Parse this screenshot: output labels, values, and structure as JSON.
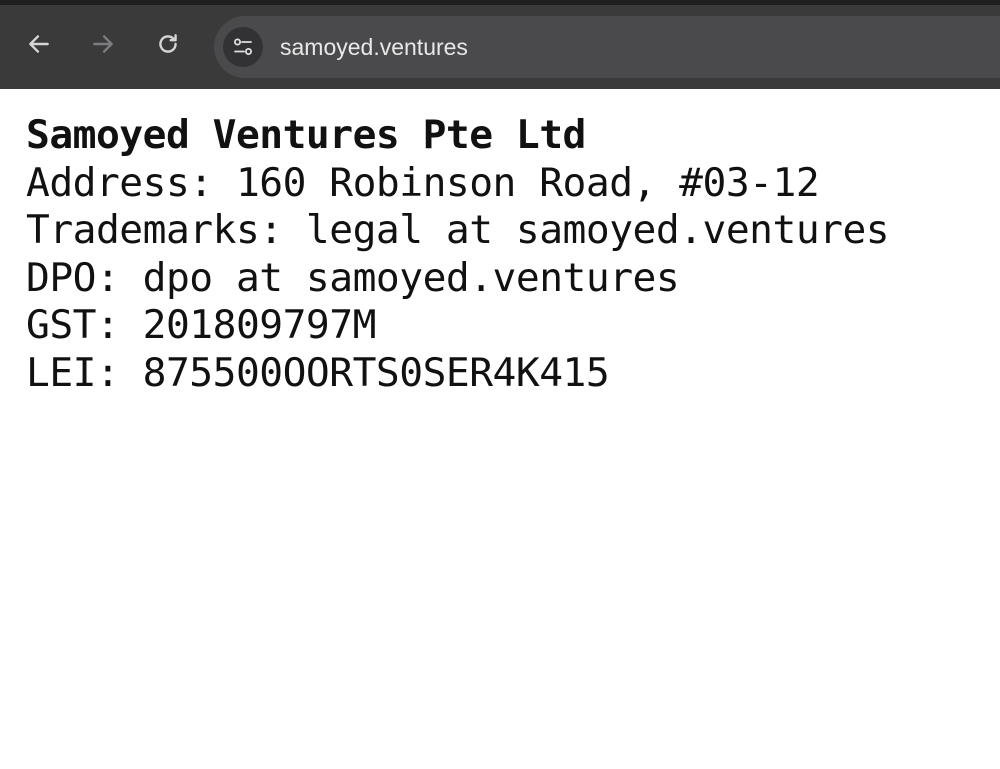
{
  "browser": {
    "url": "samoyed.ventures",
    "icons": {
      "back": "arrow-left-icon",
      "forward": "arrow-right-icon",
      "reload": "reload-icon",
      "site_info": "tune-icon"
    }
  },
  "page": {
    "company_name": "Samoyed Ventures Pte Ltd",
    "address": "Address: 160 Robinson Road, #03-12",
    "trademarks": "Trademarks: legal at samoyed.ventures",
    "dpo": "DPO: dpo at samoyed.ventures",
    "gst": "GST: 201809797M",
    "lei": "LEI: 875500OORTS0SER4K415"
  },
  "colors": {
    "toolbar": "#3a3a3b",
    "omnibox": "#4a4a4c",
    "text": "#111111"
  }
}
